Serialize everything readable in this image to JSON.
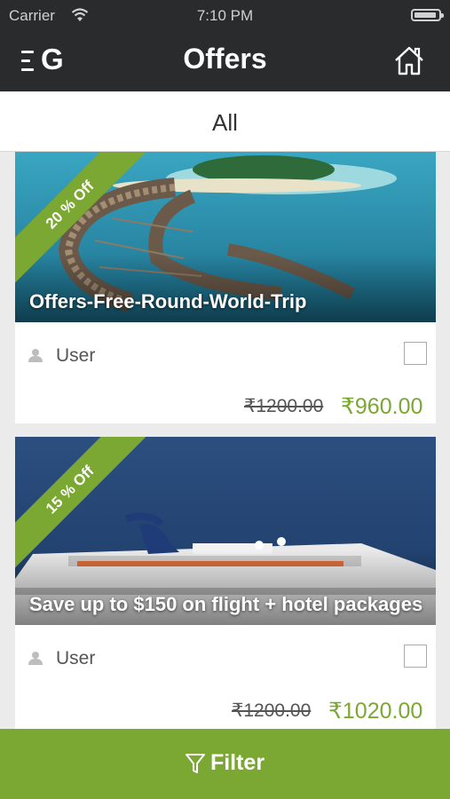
{
  "status_bar": {
    "carrier": "Carrier",
    "time": "7:10 PM"
  },
  "header": {
    "logo_text": "G",
    "title": "Offers"
  },
  "tabs": {
    "active": "All"
  },
  "offers": [
    {
      "discount": "20 % Off",
      "title": "Offers-Free-Round-World-Trip",
      "user": "User",
      "old_price": "₹1200.00",
      "new_price": "₹960.00"
    },
    {
      "discount": "15 % Off",
      "title": "Save up to $150 on flight + hotel packages",
      "user": "User",
      "old_price": "₹1200.00",
      "new_price": "₹1020.00"
    }
  ],
  "footer": {
    "filter_label": "Filter"
  },
  "colors": {
    "accent": "#7ba832",
    "nav_bg": "#2a2b2c"
  },
  "icons": [
    "wifi-icon",
    "battery-icon",
    "logo-icon",
    "home-icon",
    "user-icon",
    "filter-icon"
  ]
}
